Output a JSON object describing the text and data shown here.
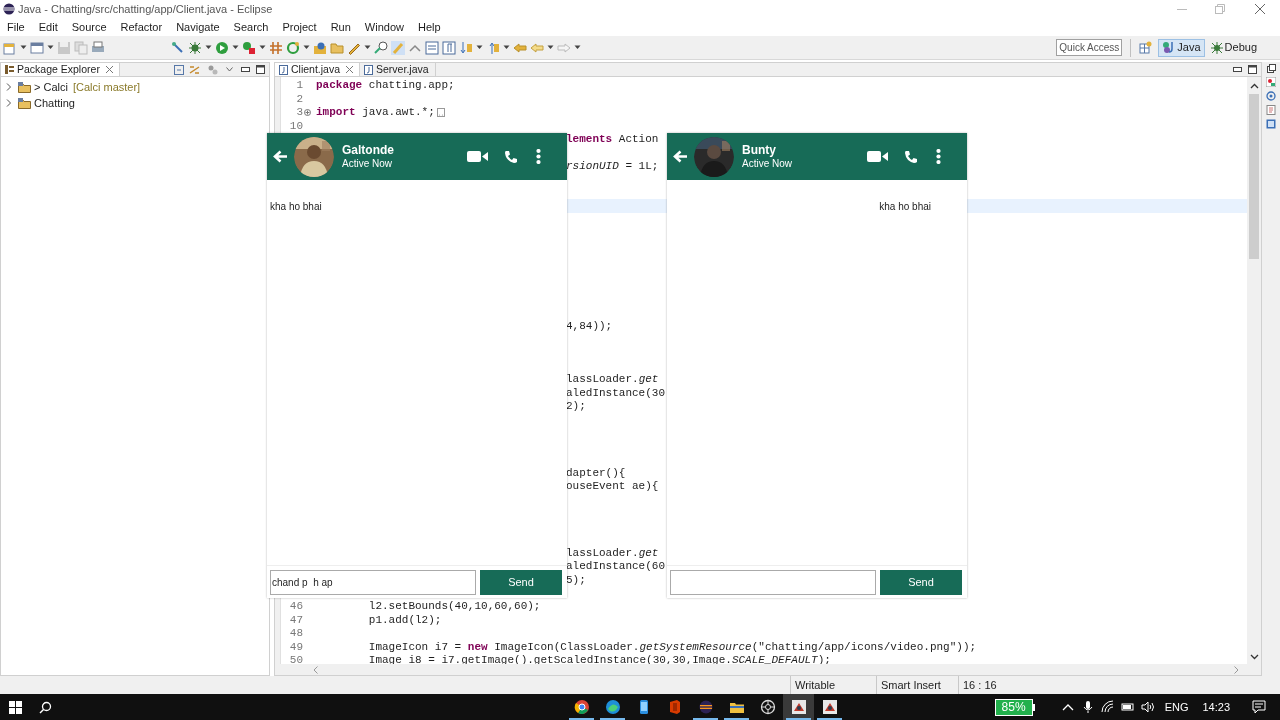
{
  "window": {
    "title": "Java - Chatting/src/chatting/app/Client.java - Eclipse"
  },
  "menu": [
    "File",
    "Edit",
    "Source",
    "Refactor",
    "Navigate",
    "Search",
    "Project",
    "Run",
    "Window",
    "Help"
  ],
  "quick_access": {
    "placeholder": "Quick Access"
  },
  "perspectives": [
    {
      "label": "Java",
      "selected": true
    },
    {
      "label": "Debug",
      "selected": false
    }
  ],
  "package_explorer": {
    "title": "Package Explorer",
    "items": [
      {
        "label": "> Calci",
        "decoration": "[Calci master]",
        "expanded": false
      },
      {
        "label": "Chatting",
        "expanded": false
      }
    ]
  },
  "editor": {
    "tabs": [
      {
        "label": "Client.java",
        "selected": true
      },
      {
        "label": "Server.java",
        "selected": false
      }
    ],
    "lines": [
      {
        "number": "1",
        "text": "**package** chatting.app;",
        "current": false,
        "folded": false
      },
      {
        "number": "2",
        "current": false,
        "folded": false
      },
      {
        "number": "3",
        "text": "**import** java.awt.*;",
        "current": false,
        "folded": true
      },
      {
        "number": "10",
        "current": false,
        "folded": false
      },
      {
        "text": "**lements** Action",
        "current": false,
        "folded": false
      },
      {
        "current": false,
        "folded": false
      },
      {
        "text": "*rsionUID* = 1L;",
        "current": false,
        "folded": false
      },
      {
        "current": false,
        "folded": false
      },
      {
        "current": false,
        "folded": false
      },
      {
        "current": true,
        "folded": false
      },
      {
        "current": false,
        "folded": false
      },
      {
        "current": false,
        "folded": false
      },
      {
        "current": false,
        "folded": false
      },
      {
        "current": false,
        "folded": false
      },
      {
        "current": false,
        "folded": false
      },
      {
        "current": false,
        "folded": false
      },
      {
        "current": false,
        "folded": false
      },
      {
        "current": false,
        "folded": false
      },
      {
        "text": "4,84));",
        "current": false,
        "folded": false
      },
      {
        "current": false,
        "folded": false
      },
      {
        "current": false,
        "folded": false
      },
      {
        "current": false,
        "folded": false
      },
      {
        "text": "lassLoader.*get*",
        "current": false,
        "folded": false
      },
      {
        "text": "aledInstance(30",
        "current": false,
        "folded": false
      },
      {
        "text": "2);",
        "current": false,
        "folded": false
      },
      {
        "current": false,
        "folded": false
      },
      {
        "current": false,
        "folded": false
      },
      {
        "current": false,
        "folded": false
      },
      {
        "current": false,
        "folded": false
      },
      {
        "text": "dapter(){",
        "current": false,
        "folded": false
      },
      {
        "text": "ouseEvent ae){",
        "current": false,
        "folded": false
      },
      {
        "current": false,
        "folded": false
      },
      {
        "current": false,
        "folded": false
      },
      {
        "current": false,
        "folded": false
      },
      {
        "current": false,
        "folded": false
      },
      {
        "text": "lassLoader.*get*",
        "current": false,
        "folded": false
      },
      {
        "text": "aledInstance(60",
        "current": false,
        "folded": false
      },
      {
        "text": "5);",
        "current": false,
        "folded": false
      },
      {
        "current": false,
        "folded": false
      },
      {
        "number": "46",
        "text": "        l2.setBounds(40,10,60,60);",
        "current": false,
        "folded": false
      },
      {
        "number": "47",
        "text": "        p1.add(l2);",
        "current": false,
        "folded": false
      },
      {
        "number": "48",
        "current": false,
        "folded": false
      },
      {
        "number": "49",
        "text": "        ImageIcon i7 = **new** ImageIcon(ClassLoader.*getSystemResource*(\"chatting/app/icons/video.png\"));",
        "current": false,
        "folded": false
      },
      {
        "number": "50",
        "text": "        Image i8 = i7.getImage().getScaledInstance(30,30,Image.*SCALE_DEFAULT*);",
        "current": false,
        "folded": false
      }
    ]
  },
  "chat_windows": [
    {
      "name": "Galtonde",
      "status": "Active Now",
      "messages": [
        {
          "text": "kha ho bhai",
          "outgoing": false
        }
      ],
      "input": {
        "value": "chand p  h ap"
      },
      "send": "Send"
    },
    {
      "name": "Bunty",
      "status": "Active Now",
      "messages": [
        {
          "text": "kha ho bhai",
          "outgoing": true
        }
      ],
      "send": "Send"
    }
  ],
  "status_bar": [
    "Writable",
    "Smart Insert",
    "16 : 16"
  ],
  "taskbar": {
    "apps": [
      {
        "kind": "browser",
        "open": true,
        "selected": false
      },
      {
        "kind": "wave",
        "open": true,
        "selected": false
      },
      {
        "kind": "phone",
        "open": false,
        "selected": false
      },
      {
        "kind": "office",
        "open": false,
        "selected": false
      },
      {
        "kind": "ide",
        "open": true,
        "selected": false
      },
      {
        "kind": "folder",
        "open": true,
        "selected": false
      },
      {
        "kind": "aperture",
        "open": false,
        "selected": false
      },
      {
        "kind": "app",
        "open": true,
        "selected": true
      },
      {
        "kind": "app",
        "open": true,
        "selected": false
      }
    ],
    "battery": "85%",
    "language": "ENG",
    "time": "14:23"
  }
}
